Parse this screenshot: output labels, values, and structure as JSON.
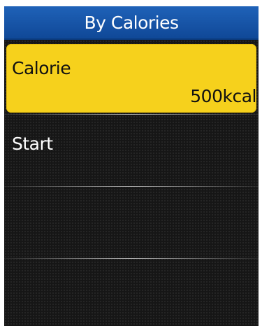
{
  "screen": {
    "title": "By Calories"
  },
  "menu": {
    "items": [
      {
        "label": "Calorie",
        "value": "500kcal",
        "selected": true
      },
      {
        "label": "Start"
      }
    ]
  },
  "colors": {
    "title_bar": "#1a5aad",
    "selection": "#f6d11c",
    "background": "#161616",
    "text_light": "#ffffff",
    "text_dark": "#111111"
  }
}
